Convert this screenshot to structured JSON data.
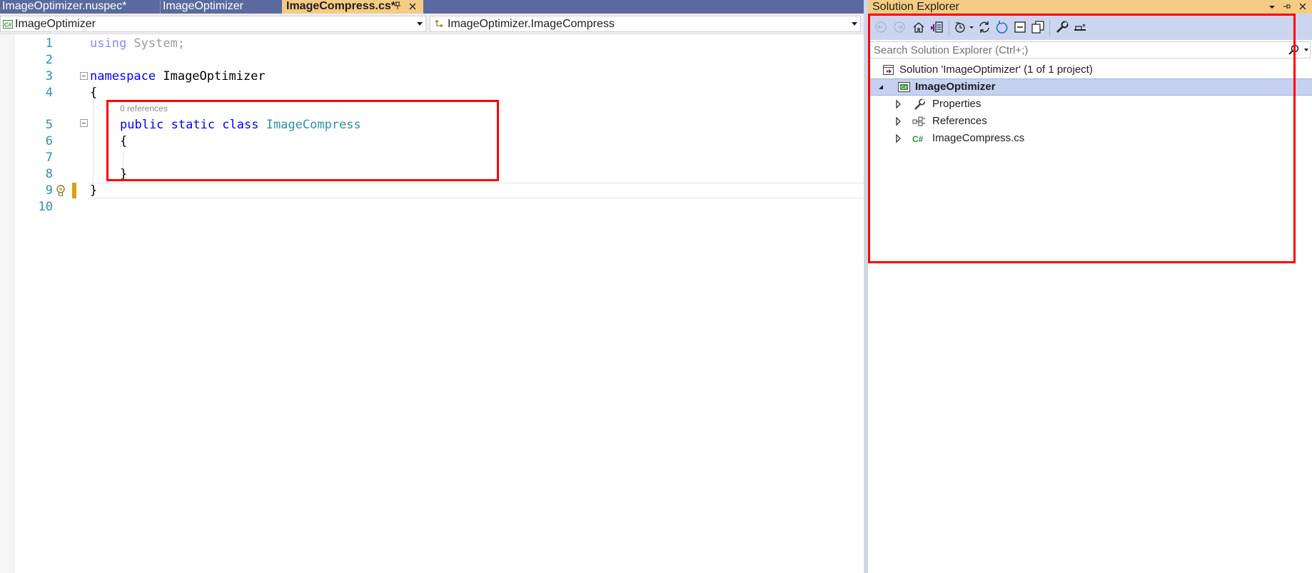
{
  "tabs": [
    {
      "label": "ImageOptimizer.nuspec*",
      "active": false
    },
    {
      "label": "ImageOptimizer",
      "active": false
    },
    {
      "label": "ImageCompress.cs*",
      "active": true
    }
  ],
  "tab_buttons": {
    "pin_icon": "pin-icon",
    "close_icon": "close-icon"
  },
  "navbar": {
    "project_combo": "ImageOptimizer",
    "type_combo": "ImageOptimizer.ImageCompress"
  },
  "editor": {
    "line_numbers": [
      "1",
      "2",
      "3",
      "4",
      "5",
      "6",
      "7",
      "8",
      "9",
      "10"
    ],
    "lines": {
      "l1_kw": "using",
      "l1_rest": " System;",
      "l3_kw": "namespace",
      "l3_rest": " ImageOptimizer",
      "l4": "{",
      "l5_kw": "public static class",
      "l5_type": " ImageCompress",
      "l6": "{",
      "l8": "}",
      "l9": "}"
    },
    "codelens": "0 references"
  },
  "solution_explorer": {
    "title": "Solution Explorer",
    "search_placeholder": "Search Solution Explorer (Ctrl+;)",
    "tree": [
      {
        "label": "Solution 'ImageOptimizer' (1 of 1 project)",
        "icon": "solution-icon"
      },
      {
        "label": "ImageOptimizer",
        "icon": "csharp-project-icon",
        "selected": true
      },
      {
        "label": "Properties",
        "icon": "wrench-icon"
      },
      {
        "label": "References",
        "icon": "references-icon"
      },
      {
        "label": "ImageCompress.cs",
        "icon": "csharp-file-icon"
      }
    ],
    "toolbar_icons": [
      "back-icon",
      "forward-icon",
      "home-icon",
      "switch-views-icon",
      "pending-changes-icon",
      "sync-icon",
      "refresh-icon",
      "collapse-all-icon",
      "show-all-files-icon",
      "properties-icon",
      "preview-icon"
    ]
  },
  "colors": {
    "accent_tab": "#f5cc84",
    "tab_bar": "#5a6a9e",
    "highlight_box": "#ff0000"
  }
}
